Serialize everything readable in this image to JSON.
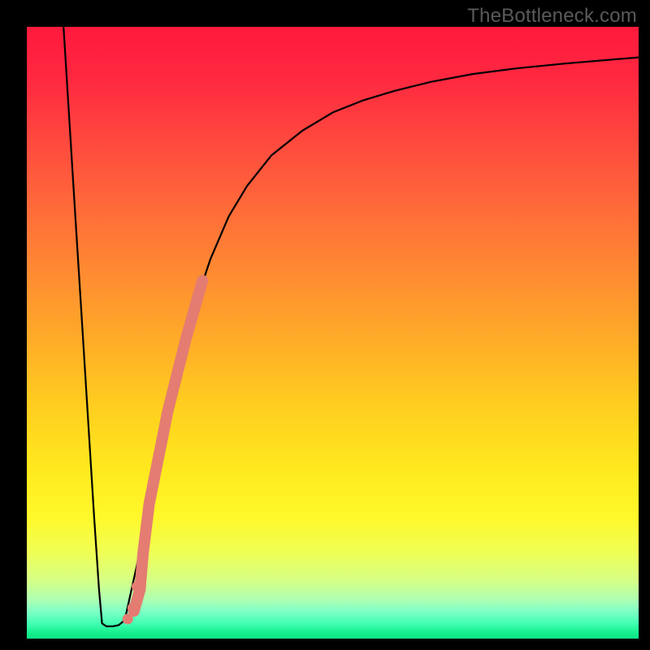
{
  "watermark": "TheBottleneck.com",
  "colors": {
    "frame": "#000000",
    "curve": "#000000",
    "accent": "#e47c72",
    "gradient_stops": [
      {
        "offset": 0.0,
        "color": "#ff1a3c"
      },
      {
        "offset": 0.08,
        "color": "#ff2740"
      },
      {
        "offset": 0.2,
        "color": "#ff4d3e"
      },
      {
        "offset": 0.35,
        "color": "#ff7b36"
      },
      {
        "offset": 0.5,
        "color": "#ffa829"
      },
      {
        "offset": 0.62,
        "color": "#ffce1f"
      },
      {
        "offset": 0.72,
        "color": "#ffe81e"
      },
      {
        "offset": 0.8,
        "color": "#fff82a"
      },
      {
        "offset": 0.86,
        "color": "#efff55"
      },
      {
        "offset": 0.905,
        "color": "#d6ff86"
      },
      {
        "offset": 0.935,
        "color": "#b0ffb0"
      },
      {
        "offset": 0.955,
        "color": "#80ffc6"
      },
      {
        "offset": 0.975,
        "color": "#44ffb3"
      },
      {
        "offset": 0.99,
        "color": "#16f08e"
      },
      {
        "offset": 1.0,
        "color": "#0ee386"
      }
    ]
  },
  "chart_data": {
    "type": "line",
    "title": "",
    "xlabel": "",
    "ylabel": "",
    "xlim": [
      0,
      100
    ],
    "ylim": [
      0,
      100
    ],
    "grid": false,
    "series": [
      {
        "name": "left-branch",
        "x": [
          6.0,
          7.0,
          8.0,
          9.0,
          10.0,
          11.0,
          11.8,
          12.3
        ],
        "y": [
          100.0,
          84.0,
          68.0,
          52.0,
          36.0,
          20.0,
          8.0,
          2.5
        ]
      },
      {
        "name": "valley",
        "x": [
          12.3,
          13.0,
          14.0,
          15.0,
          16.0
        ],
        "y": [
          2.5,
          2.0,
          2.0,
          2.2,
          3.0
        ]
      },
      {
        "name": "right-branch",
        "x": [
          16.0,
          18.0,
          20.0,
          22.0,
          24.0,
          26.0,
          28.0,
          30.0,
          33.0,
          36.0,
          40.0,
          45.0,
          50.0,
          55.0,
          60.0,
          66.0,
          73.0,
          80.0,
          88.0,
          100.0
        ],
        "y": [
          3.0,
          12.0,
          22.0,
          32.0,
          41.0,
          49.0,
          56.0,
          62.0,
          69.0,
          74.0,
          79.0,
          83.0,
          86.0,
          88.0,
          89.5,
          91.0,
          92.3,
          93.2,
          94.0,
          95.0
        ]
      }
    ],
    "highlight_segment": {
      "name": "accent-band",
      "style": "thick-dots",
      "x": [
        17.5,
        18.5,
        19.0,
        20.0,
        21.0,
        22.0,
        23.0,
        24.0,
        25.0,
        26.0,
        27.0,
        28.0,
        28.7
      ],
      "y": [
        4.5,
        8.0,
        14.0,
        22.0,
        27.0,
        32.0,
        37.0,
        41.0,
        45.0,
        49.0,
        52.5,
        56.0,
        58.5
      ]
    },
    "highlight_dots": {
      "name": "accent-dots-low",
      "x": [
        16.5,
        17.3,
        18.0
      ],
      "y": [
        3.2,
        5.0,
        8.5
      ]
    }
  }
}
